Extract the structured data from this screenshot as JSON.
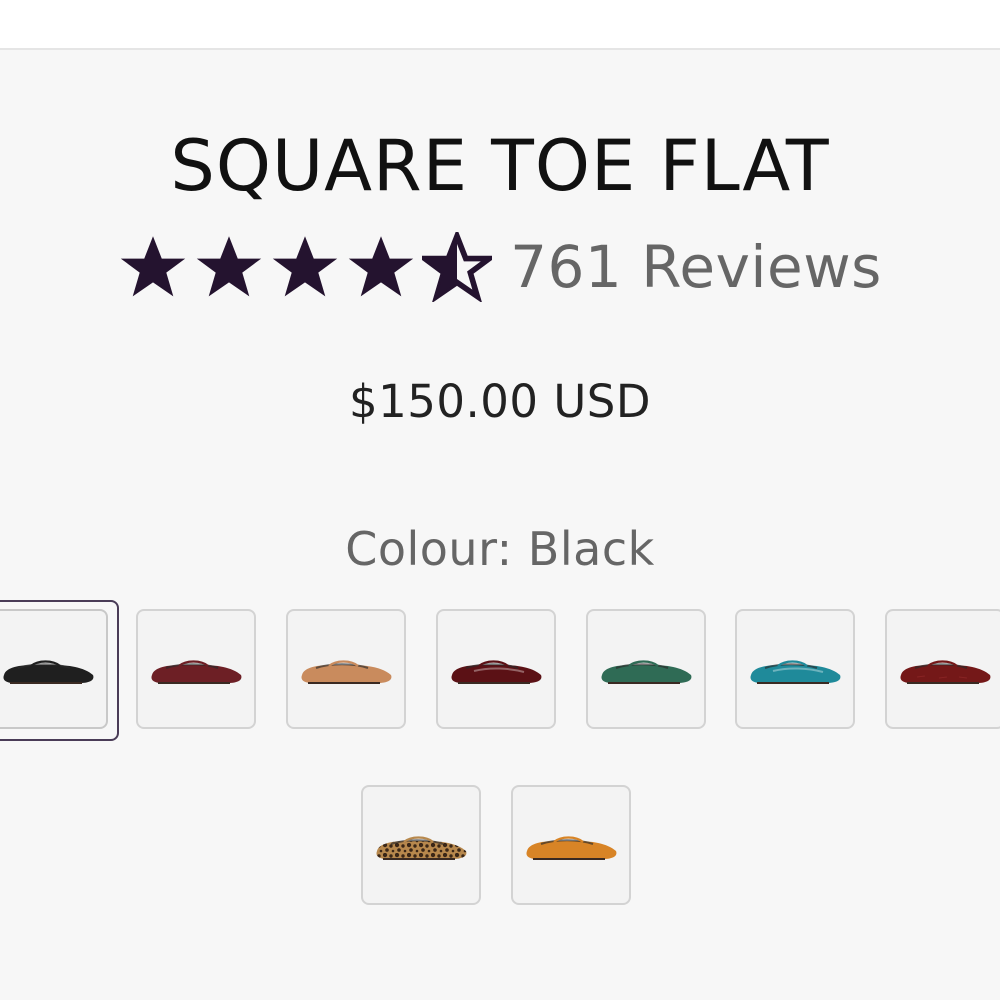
{
  "product": {
    "title": "SQUARE TOE FLAT",
    "rating": 4.5,
    "review_count_label": "761 Reviews",
    "price": "$150.00 USD",
    "colour_label": "Colour: Black"
  },
  "colors": {
    "star": "#24132f",
    "selected_border": "#4a3c57",
    "swatch_border": "#d3d3d3",
    "background": "#f7f7f7"
  },
  "swatches": [
    {
      "name": "Black",
      "color": "#1f1f1f",
      "selected": true,
      "pattern": "solid"
    },
    {
      "name": "Burgundy",
      "color": "#6d1f25",
      "selected": false,
      "pattern": "solid"
    },
    {
      "name": "Tan",
      "color": "#c98b5d",
      "selected": false,
      "pattern": "solid"
    },
    {
      "name": "Wine Patent",
      "color": "#5b1115",
      "selected": false,
      "pattern": "patent"
    },
    {
      "name": "Green",
      "color": "#2f6b55",
      "selected": false,
      "pattern": "solid"
    },
    {
      "name": "Teal Patent",
      "color": "#1f8a9a",
      "selected": false,
      "pattern": "patent"
    },
    {
      "name": "Red Suede",
      "color": "#741818",
      "selected": false,
      "pattern": "suede"
    },
    {
      "name": "Leopard",
      "color": "#b7884d",
      "selected": false,
      "pattern": "leopard"
    },
    {
      "name": "Orange",
      "color": "#d88426",
      "selected": false,
      "pattern": "solid"
    }
  ]
}
